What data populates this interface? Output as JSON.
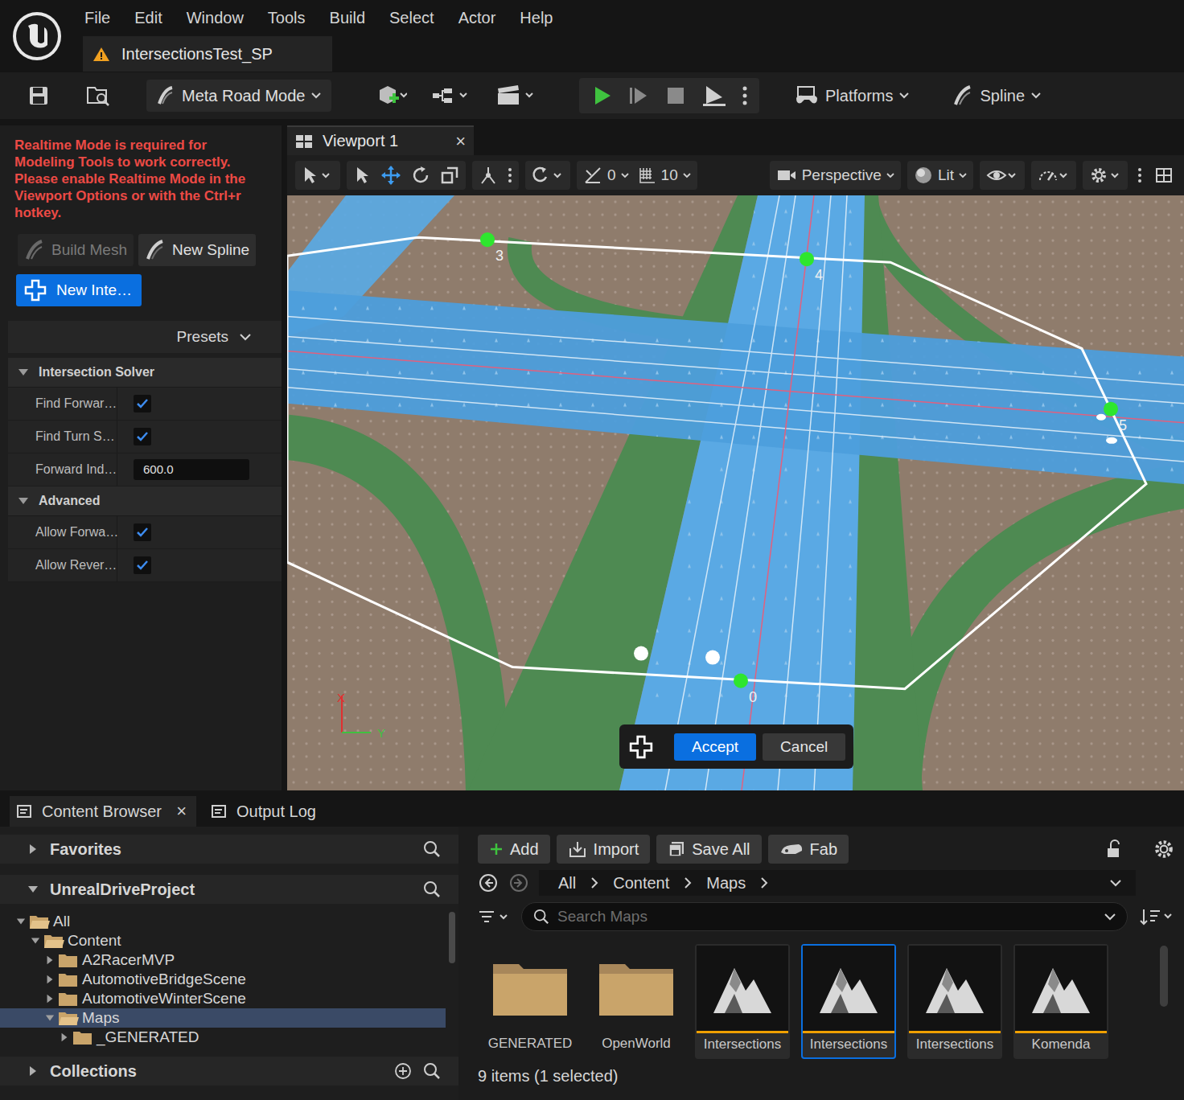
{
  "menu": [
    "File",
    "Edit",
    "Window",
    "Tools",
    "Build",
    "Select",
    "Actor",
    "Help"
  ],
  "level_tab": {
    "title": "IntersectionsTest_SP"
  },
  "toolbar": {
    "mode": "Meta Road Mode",
    "platforms": "Platforms",
    "spline": "Spline"
  },
  "mode_panel": {
    "warning": "Realtime Mode is required for Modeling Tools to work correctly. Please enable Realtime Mode in the Viewport Options or with the Ctrl+r hotkey.",
    "buttons": [
      {
        "label": "Build Mesh",
        "disabled": true
      },
      {
        "label": "New Spline",
        "disabled": false
      }
    ],
    "primary_button": "New Inte…",
    "presets": "Presets",
    "sections": [
      {
        "title": "Intersection Solver",
        "expanded": true,
        "rows": [
          {
            "label": "Find Forwar…",
            "kind": "checkbox",
            "checked": true
          },
          {
            "label": "Find Turn S…",
            "kind": "checkbox",
            "checked": true
          },
          {
            "label": "Forward Ind…",
            "kind": "number",
            "value": "600.0"
          }
        ]
      },
      {
        "title": "Advanced",
        "expanded": true,
        "rows": [
          {
            "label": "Allow Forwa…",
            "kind": "checkbox",
            "checked": true
          },
          {
            "label": "Allow Rever…",
            "kind": "checkbox",
            "checked": true
          }
        ]
      }
    ]
  },
  "viewport": {
    "tab": "Viewport 1",
    "close": "×",
    "rotation_snap": "0",
    "grid_snap": "10",
    "view_mode": "Perspective",
    "lighting": "Lit",
    "points": [
      "3",
      "4",
      "5",
      "0"
    ],
    "axes": [
      "X",
      "Y"
    ],
    "actions": [
      {
        "label": "Accept",
        "primary": true
      },
      {
        "label": "Cancel",
        "primary": false
      }
    ]
  },
  "bottom_tabs": [
    {
      "label": "Content Browser",
      "selected": true,
      "close": "×"
    },
    {
      "label": "Output Log",
      "selected": false,
      "close": ""
    }
  ],
  "content_browser": {
    "sources": [
      {
        "label": "Favorites",
        "expanded": false
      },
      {
        "label": "UnrealDriveProject",
        "expanded": true
      }
    ],
    "tree": [
      {
        "label": "All",
        "depth": 0,
        "expanded": true,
        "selected": false
      },
      {
        "label": "Content",
        "depth": 1,
        "expanded": true,
        "selected": false
      },
      {
        "label": "A2RacerMVP",
        "depth": 2,
        "expanded": false,
        "selected": false
      },
      {
        "label": "AutomotiveBridgeScene",
        "depth": 2,
        "expanded": false,
        "selected": false
      },
      {
        "label": "AutomotiveWinterScene",
        "depth": 2,
        "expanded": false,
        "selected": false
      },
      {
        "label": "Maps",
        "depth": 2,
        "expanded": true,
        "selected": true
      },
      {
        "label": "_GENERATED",
        "depth": 3,
        "expanded": false,
        "selected": false
      }
    ],
    "collections": {
      "label": "Collections",
      "expanded": false
    },
    "actions": [
      "Add",
      "Import",
      "Save All",
      "Fab"
    ],
    "path": [
      "All",
      "Content",
      "Maps"
    ],
    "search_placeholder": "Search Maps",
    "assets": [
      {
        "label": "GENERATED",
        "kind": "folder",
        "selected": false
      },
      {
        "label": "OpenWorld",
        "kind": "folder",
        "selected": false
      },
      {
        "label": "Intersections",
        "kind": "map",
        "selected": false
      },
      {
        "label": "Intersections",
        "kind": "map",
        "selected": true
      },
      {
        "label": "Intersections",
        "kind": "map",
        "selected": false
      },
      {
        "label": "Komenda",
        "kind": "map",
        "selected": false
      }
    ],
    "status": "9 items (1 selected)"
  }
}
